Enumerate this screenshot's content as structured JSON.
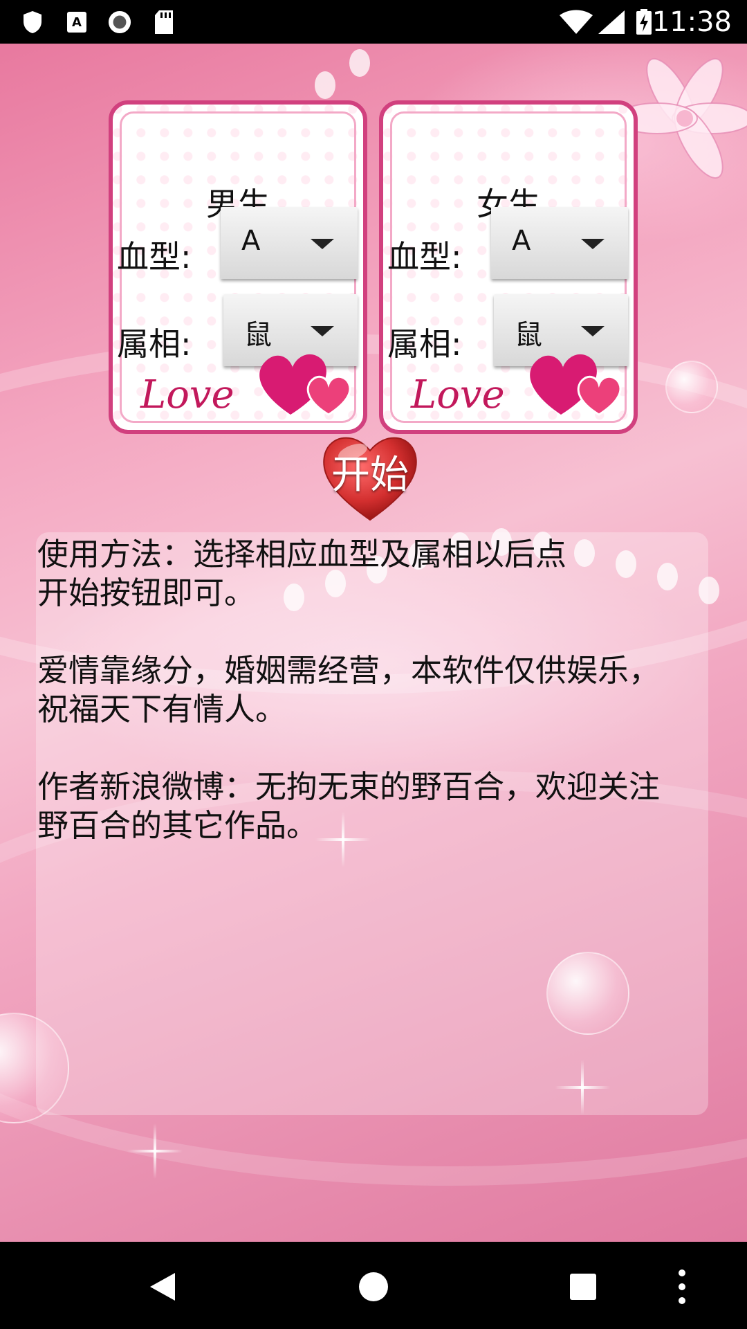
{
  "status_bar": {
    "time": "11:38",
    "icons": [
      "shield-icon",
      "font-a-icon",
      "record-icon",
      "sd-card-icon",
      "wifi-icon",
      "signal-icon",
      "battery-charging-icon"
    ]
  },
  "male_card": {
    "title": "男生",
    "blood_label": "血型:",
    "blood_value": "A",
    "zodiac_label": "属相:",
    "zodiac_value": "鼠"
  },
  "female_card": {
    "title": "女生",
    "blood_label": "血型:",
    "blood_value": "A",
    "zodiac_label": "属相:",
    "zodiac_value": "鼠"
  },
  "start_button": {
    "label": "开始"
  },
  "info": {
    "paragraphs": [
      "使用方法：选择相应血型及属相以后点\n开始按钮即可。",
      "爱情靠缘分，婚姻需经营，本软件仅供娱乐，\n祝福天下有情人。",
      "作者新浪微博：无拘无束的野百合，欢迎关注\n野百合的其它作品。"
    ]
  },
  "colors": {
    "card_border": "#d1407e",
    "heart_red": "#d32f2f",
    "background_pink": "#f4a7c1"
  },
  "nav_bar": {
    "icons": [
      "back-icon",
      "home-icon",
      "recents-icon",
      "more-icon"
    ]
  }
}
